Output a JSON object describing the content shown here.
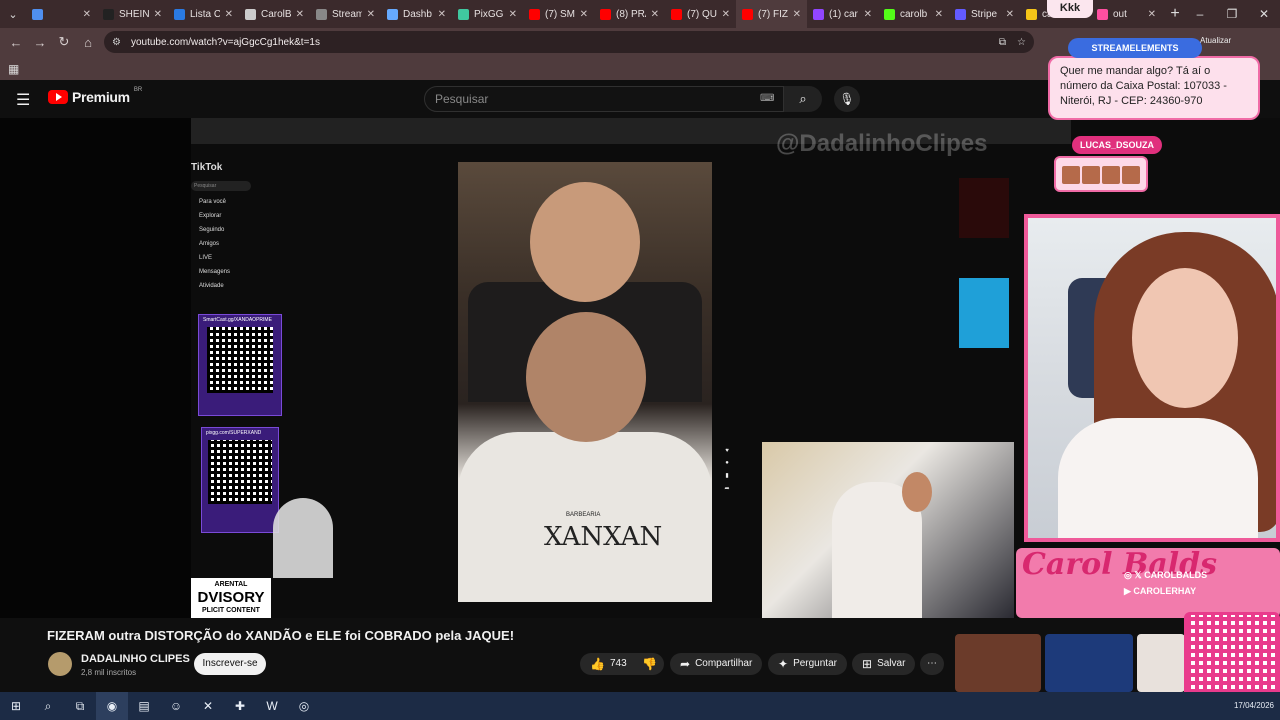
{
  "browser": {
    "tabs": [
      {
        "label": "",
        "color": "#4f8ff0"
      },
      {
        "label": "SHEIN",
        "color": "#222222"
      },
      {
        "label": "Lista C",
        "color": "#2a7ae2"
      },
      {
        "label": "CarolB",
        "color": "#cccccc"
      },
      {
        "label": "Stream",
        "color": "#888888"
      },
      {
        "label": "Dashb",
        "color": "#66aaff"
      },
      {
        "label": "PixGG",
        "color": "#40c8a0"
      },
      {
        "label": "(7) SM",
        "color": "#ff0000"
      },
      {
        "label": "(8) PRA",
        "color": "#ff0000"
      },
      {
        "label": "(7) QU",
        "color": "#ff0000"
      },
      {
        "label": "(7) FIZ",
        "color": "#ff0000"
      },
      {
        "label": "(1) car",
        "color": "#9146ff"
      },
      {
        "label": "carolb",
        "color": "#53fc18"
      },
      {
        "label": "Stripe",
        "color": "#635bff"
      },
      {
        "label": "carole",
        "color": "#f5c518"
      },
      {
        "label": "out",
        "color": "#ff4fa0"
      }
    ],
    "url": "youtube.com/watch?v=ajGgcCg1hek&t=1s",
    "update_label": "Atualizar"
  },
  "youtube": {
    "logo_text": "Premium",
    "country_code": "BR",
    "search_placeholder": "Pesquisar",
    "video_title": "FIZERAM outra DISTORÇÃO do XANDÃO e ELE foi COBRADO pela JAQUE!",
    "channel_name": "DADALINHO CLIPES",
    "channel_subs": "2,8 mil inscritos",
    "subscribe_label": "Inscrever-se",
    "like_count": "743",
    "share_label": "Compartilhar",
    "ask_label": "Perguntar",
    "save_label": "Salvar"
  },
  "stream": {
    "watermark": "@DadalinhoClipes",
    "tiktok_logo": "TikTok",
    "tiktok_search": "Pesquisar",
    "tiktok_nav": [
      "Para você",
      "Explorar",
      "Seguindo",
      "Amigos",
      "LIVE",
      "Mensagens",
      "Atividade"
    ],
    "qr1_label": "SmartCast.gg/XANDAOPRIME",
    "qr2_label": "pixgg.com/SUPERXAND",
    "apron_small": "BARBEARIA",
    "apron_text": "XANXAN",
    "advisory_top": "ARENTAL",
    "advisory_mid": "DVISORY",
    "advisory_bottom": "PLICIT CONTENT",
    "kkk_text": "Kkk",
    "streamelements_label": "STREAMELEMENTS",
    "bubble_text": "Quer me mandar algo? Tá aí o número da Caixa Postal: 107033 - Niterói, RJ - CEP: 24360-970",
    "lucas_label": "LUCAS_DSOUZA",
    "carol_logo": "Carol Balds",
    "social_x": "CAROLBALDS",
    "social_yt": "CAROLERHAY"
  },
  "taskbar": {
    "date": "17/04/2026"
  }
}
